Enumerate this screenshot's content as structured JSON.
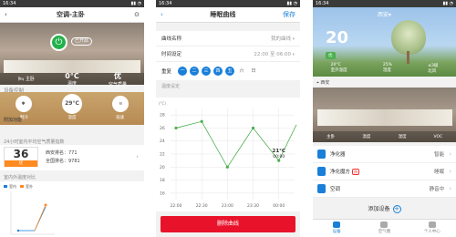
{
  "screen1": {
    "status_time": "16:34",
    "title": "空调-主卧",
    "onoff_label": "已开启",
    "info": [
      {
        "value": "",
        "label": "主卧"
      },
      {
        "value": "0°C",
        "label": "温度"
      },
      {
        "value": "优",
        "label": "空气质量"
      }
    ],
    "section_device_control": "设备控制",
    "controls": [
      {
        "text": "✱",
        "label": "制冷"
      },
      {
        "text": "29°C",
        "label": "温度"
      },
      {
        "text": "≋",
        "label": "低速"
      }
    ],
    "add_function": "附加功能",
    "aq_title": "24小时室内平均空气质量指数",
    "aq_value": "36",
    "aq_badge": "优",
    "aq_lines": [
      "西安排名：771",
      "全国排名：9781"
    ],
    "compare_title": "室内外温度对比",
    "legend": [
      "室内",
      "室外"
    ]
  },
  "screen2": {
    "status_time": "16:34",
    "back": "‹",
    "title": "睡眠曲线",
    "save": "保存",
    "rows": [
      {
        "label": "曲线名称",
        "value": "我的曲线"
      },
      {
        "label": "时间设定",
        "value": "22:00 至 06:00"
      }
    ],
    "repeat_label": "重复",
    "days": [
      {
        "d": "一",
        "on": true
      },
      {
        "d": "二",
        "on": true
      },
      {
        "d": "三",
        "on": true
      },
      {
        "d": "四",
        "on": true
      },
      {
        "d": "五",
        "on": true
      },
      {
        "d": "六",
        "on": false
      },
      {
        "d": "日",
        "on": false
      }
    ],
    "temp_setting": "温度设定",
    "delete_button": "删除曲线"
  },
  "chart_data": {
    "type": "line",
    "ylabel": "(°C)",
    "y_ticks": [
      16,
      18,
      20,
      22,
      24,
      26,
      28
    ],
    "ylim": [
      15,
      29
    ],
    "x": [
      "22:00",
      "22:30",
      "23:00",
      "23:30",
      "00:00"
    ],
    "series": [
      {
        "values": [
          26,
          27,
          20,
          26,
          21
        ]
      }
    ],
    "annotation": {
      "text": "21°C",
      "sub": "00:00"
    },
    "extra_point": 26.5,
    "grid": true,
    "line_color": "#4caf50"
  },
  "screen3": {
    "status_time": "16:34",
    "city_top": "西安",
    "temp": "20",
    "badge": "优",
    "stats": [
      {
        "value": "20°C",
        "label": "室外温度"
      },
      {
        "value": "25%",
        "label": "湿度"
      },
      {
        "value": "≤3级",
        "label": "北风"
      }
    ],
    "location": "西安",
    "room_info": [
      "主卧",
      "温度",
      "湿度",
      "VOC"
    ],
    "devices": [
      {
        "name": "净化器",
        "status": "智能",
        "hot": ""
      },
      {
        "name": "净化魔方",
        "status": "睡眠",
        "hot": "热"
      },
      {
        "name": "空调",
        "status": "静音中",
        "hot": ""
      }
    ],
    "add_device": "添加设备",
    "tabs": [
      "设备",
      "空气圈",
      "个人中心"
    ]
  }
}
